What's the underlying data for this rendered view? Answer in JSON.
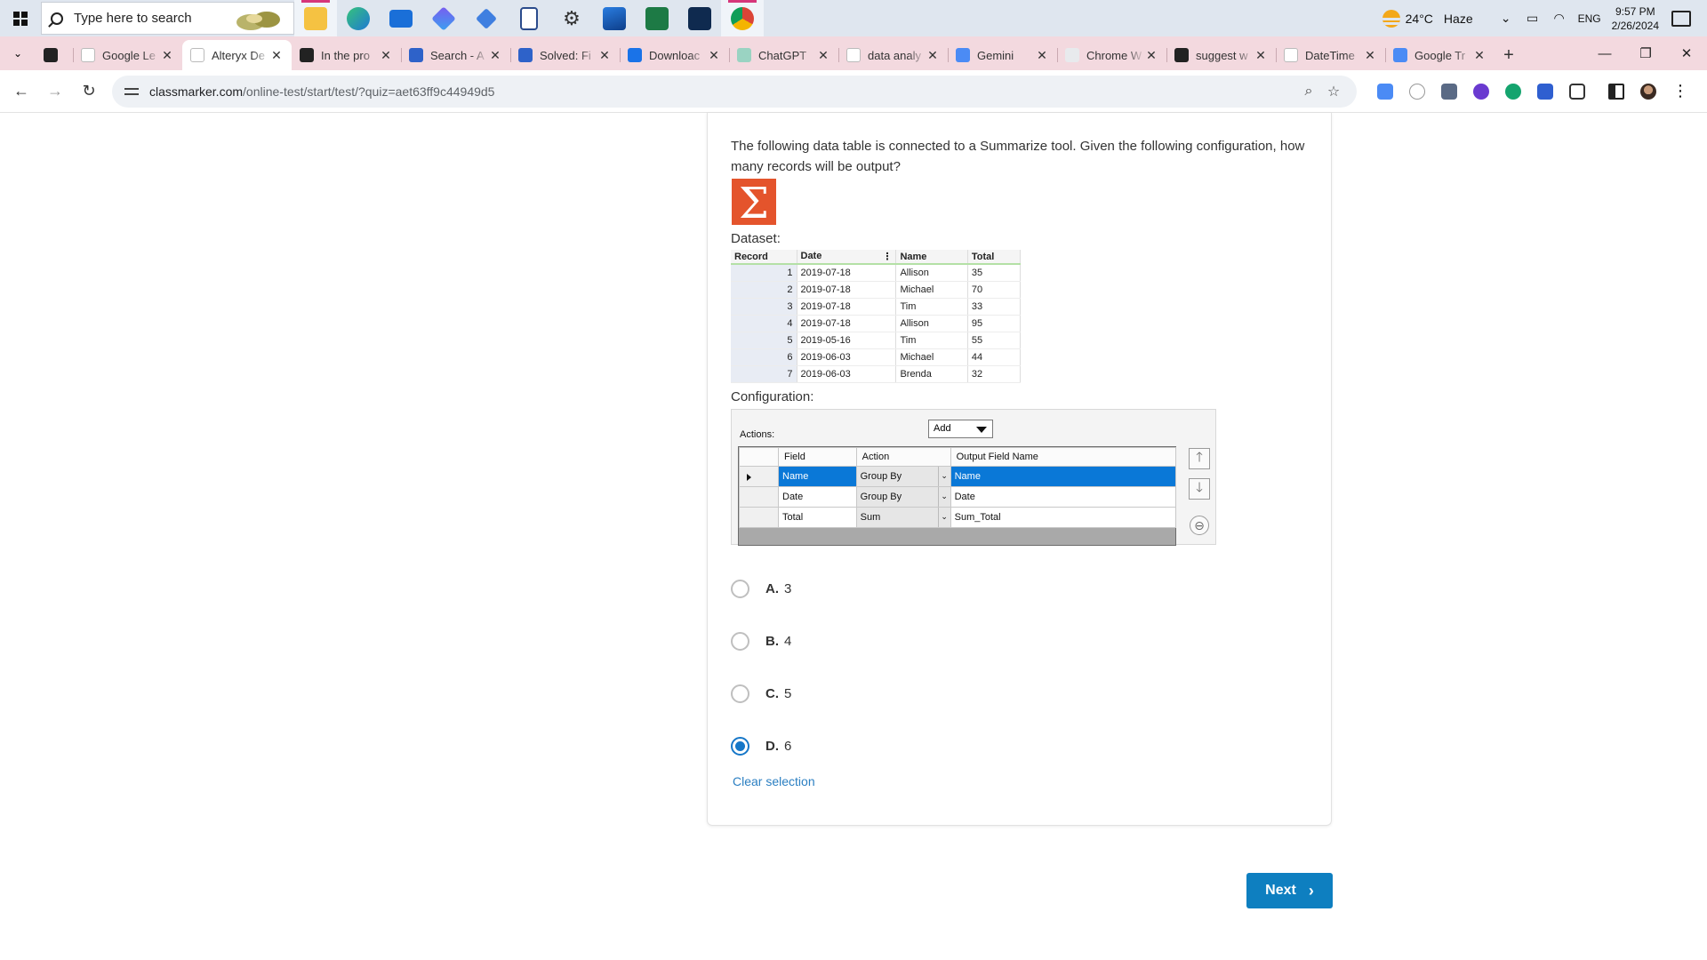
{
  "taskbar": {
    "search_placeholder": "Type here to search",
    "weather": {
      "temp": "24°C",
      "condition": "Haze"
    },
    "language": "ENG",
    "time": "9:57 PM",
    "date": "2/26/2024"
  },
  "tabs": [
    {
      "title": "",
      "favicon": "openai-icon",
      "color": "#222222"
    },
    {
      "title": "Google Le",
      "favicon": "google-icon",
      "color": "#ffffff"
    },
    {
      "title": "Alteryx De",
      "favicon": "check-icon",
      "color": "#ffffff",
      "active": true
    },
    {
      "title": "In the pro",
      "favicon": "flag-icon",
      "color": "#222222"
    },
    {
      "title": "Search - A",
      "favicon": "a-icon",
      "color": "#2e62c9"
    },
    {
      "title": "Solved: Fi",
      "favicon": "a-icon",
      "color": "#2e62c9"
    },
    {
      "title": "Downloac",
      "favicon": "download-icon",
      "color": "#1a73e8"
    },
    {
      "title": "ChatGPT",
      "favicon": "openai-icon",
      "color": "#9ad3c2"
    },
    {
      "title": "data analy",
      "favicon": "google-icon",
      "color": "#ffffff"
    },
    {
      "title": "Gemini",
      "favicon": "gemini-icon",
      "color": "#4b8bf5"
    },
    {
      "title": "Chrome W",
      "favicon": "chrome-icon",
      "color": "#e8eaed"
    },
    {
      "title": "suggest w",
      "favicon": "openai-icon",
      "color": "#222222"
    },
    {
      "title": "DateTime",
      "favicon": "google-icon",
      "color": "#ffffff"
    },
    {
      "title": "Google Tr",
      "favicon": "translate-icon",
      "color": "#4b8bf5"
    }
  ],
  "address_bar": {
    "url_host": "classmarker.com",
    "url_path": "/online-test/start/test/?quiz=aet63ff9c44949d5"
  },
  "question": {
    "text": "The following data table is connected to a Summarize tool. Given the following configuration, how many records will be output?",
    "dataset_label": "Dataset:",
    "configuration_label": "Configuration:"
  },
  "dataset": {
    "headers": [
      "Record",
      "Date",
      "Name",
      "Total"
    ],
    "rows": [
      [
        "1",
        "2019-07-18",
        "Allison",
        "35"
      ],
      [
        "2",
        "2019-07-18",
        "Michael",
        "70"
      ],
      [
        "3",
        "2019-07-18",
        "Tim",
        "33"
      ],
      [
        "4",
        "2019-07-18",
        "Allison",
        "95"
      ],
      [
        "5",
        "2019-05-16",
        "Tim",
        "55"
      ],
      [
        "6",
        "2019-06-03",
        "Michael",
        "44"
      ],
      [
        "7",
        "2019-06-03",
        "Brenda",
        "32"
      ]
    ]
  },
  "configuration": {
    "actions_label": "Actions:",
    "add_label": "Add",
    "headers": [
      "Field",
      "Action",
      "Output Field Name"
    ],
    "rows": [
      [
        "Name",
        "Group By",
        "Name"
      ],
      [
        "Date",
        "Group By",
        "Date"
      ],
      [
        "Total",
        "Sum",
        "Sum_Total"
      ]
    ]
  },
  "options": [
    {
      "letter": "A.",
      "value": "3",
      "checked": false
    },
    {
      "letter": "B.",
      "value": "4",
      "checked": false
    },
    {
      "letter": "C.",
      "value": "5",
      "checked": false
    },
    {
      "letter": "D.",
      "value": "6",
      "checked": true
    }
  ],
  "clear_selection_label": "Clear selection",
  "next_label": "Next"
}
